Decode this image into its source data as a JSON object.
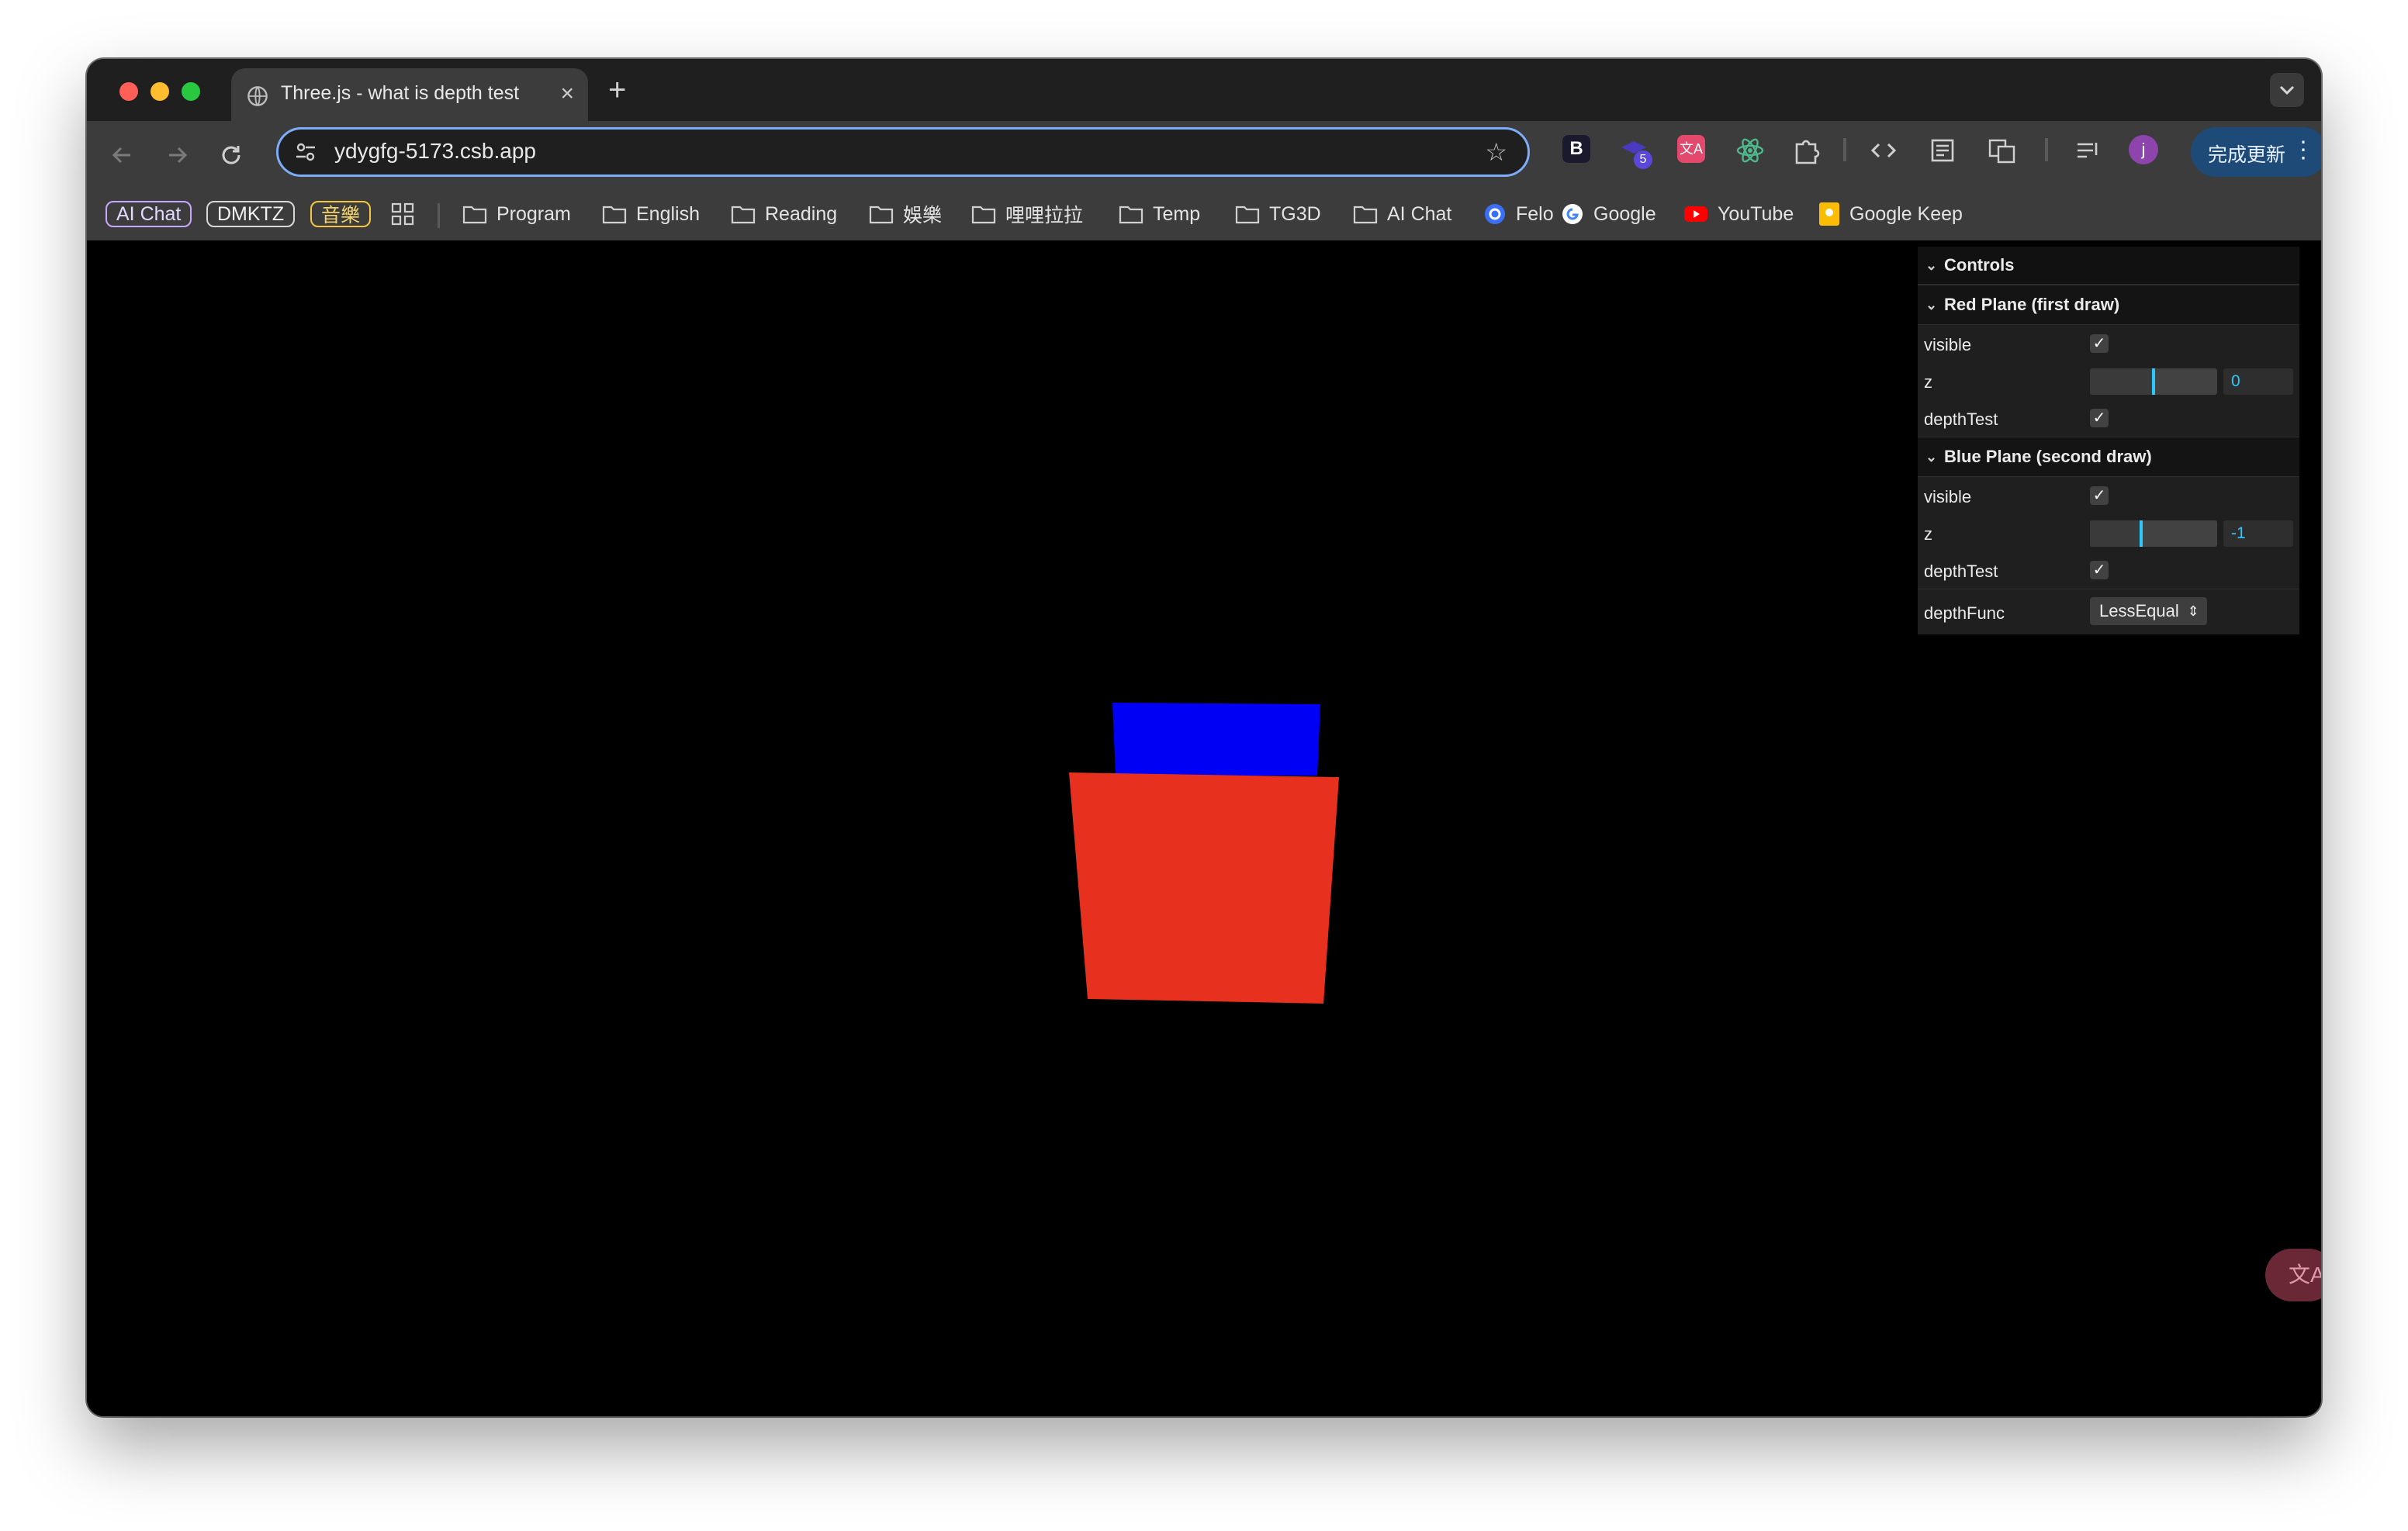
{
  "browser": {
    "tab": {
      "title": "Three.js - what is depth test",
      "close_icon": "×"
    },
    "new_tab_icon": "+",
    "url": "ydygfg-5173.csb.app",
    "update_button_label": "完成更新",
    "update_menu_icon": "⋮",
    "extension_badge": "5",
    "profile_initial": "j",
    "extension_b_label": "B",
    "translate_fab_icon": "文A"
  },
  "bookmarks": {
    "chips": [
      {
        "label": "AI Chat",
        "color": "#c8a8ff"
      },
      {
        "label": "DMKTZ",
        "color": "#d8d8d8"
      },
      {
        "label": "音樂",
        "color": "#f5c542"
      }
    ],
    "folders": [
      "Program",
      "English",
      "Reading",
      "娛樂",
      "哩哩拉拉",
      "Temp",
      "TG3D",
      "AI Chat"
    ],
    "links": [
      "Felo",
      "Google",
      "YouTube",
      "Google Keep"
    ]
  },
  "gui": {
    "title": "Controls",
    "red_folder": {
      "title": "Red Plane (first draw)",
      "visible_label": "visible",
      "z_label": "z",
      "z_value": "0",
      "z_fraction": 0.5,
      "depth_test_label": "depthTest",
      "visible": true,
      "depth_test": true
    },
    "blue_folder": {
      "title": "Blue Plane (second draw)",
      "visible_label": "visible",
      "z_label": "z",
      "z_value": "-1",
      "z_fraction": 0.4,
      "depth_test_label": "depthTest",
      "visible": true,
      "depth_test": true
    },
    "depth_func_label": "depthFunc",
    "depth_func_value": "LessEqual",
    "check_glyph": "✓",
    "chevron_glyph": "⌄",
    "select_arrow_glyph": "⇕"
  },
  "scene": {
    "background": "#000000",
    "red_plane_color": "#e8301f",
    "blue_plane_color": "#0000f5"
  }
}
